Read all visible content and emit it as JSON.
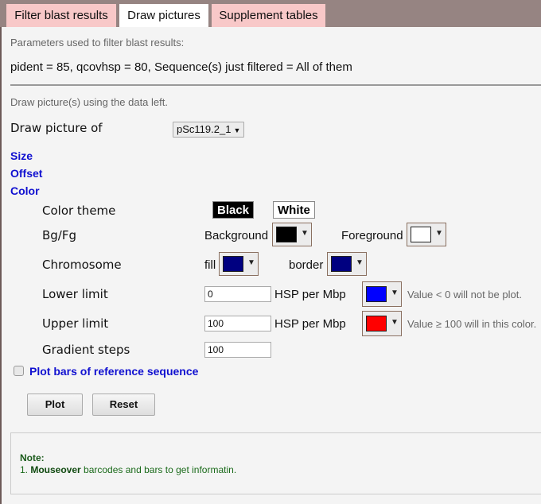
{
  "tabs": [
    {
      "label": "Filter blast results",
      "active": false
    },
    {
      "label": "Draw pictures",
      "active": true
    },
    {
      "label": "Supplement tables",
      "active": false
    }
  ],
  "params": {
    "heading": "Parameters used to filter blast results:",
    "summary": "pident = 85, qcovhsp = 80, Sequence(s) just filtered = All of them"
  },
  "draw": {
    "heading": "Draw picture(s) using the data left.",
    "draw_of_label": "Draw picture of",
    "draw_of_selected": "pSc119.2_1"
  },
  "sections": {
    "size": "Size",
    "offset": "Offset",
    "color": "Color"
  },
  "color": {
    "theme_label": "Color theme",
    "theme_black": "Black",
    "theme_white": "White",
    "bgfg_label": "Bg/Fg",
    "background_label": "Background",
    "background_color": "#000000",
    "foreground_label": "Foreground",
    "foreground_color": "#ffffff",
    "chromosome_label": "Chromosome",
    "fill_label": "fill",
    "fill_color": "#000080",
    "border_label": "border",
    "border_color": "#000080",
    "lower_label": "Lower limit",
    "lower_value": "0",
    "lower_unit": "HSP per Mbp",
    "lower_color": "#0000ff",
    "lower_hint": "Value < 0 will not be plot.",
    "upper_label": "Upper limit",
    "upper_value": "100",
    "upper_unit": "HSP per Mbp",
    "upper_color": "#ff0000",
    "upper_hint": "Value ≥ 100 will in this color.",
    "gradient_label": "Gradient steps",
    "gradient_value": "100"
  },
  "plot_bars": {
    "label": "Plot bars of reference sequence",
    "checked": false
  },
  "buttons": {
    "plot": "Plot",
    "reset": "Reset"
  },
  "note": {
    "title": "Note:",
    "prefix": "1. ",
    "bold": "Mouseover",
    "rest": " barcodes and bars to get informatin."
  },
  "icons": {
    "dropdown": "▼"
  }
}
